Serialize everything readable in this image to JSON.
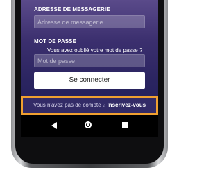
{
  "login": {
    "email_label": "ADRESSE DE MESSAGERIE",
    "email_placeholder": "Adresse de messagerie",
    "password_label": "MOT DE PASSE",
    "forgot_password": "Vous avez oublié votre mot de passe ?",
    "password_placeholder": "Mot de passe",
    "connect_button": "Se connecter"
  },
  "signup": {
    "prompt": "Vous n'avez pas de compte ?",
    "link": "Inscrivez-vous"
  },
  "navbar": {
    "back_icon": "back-triangle-icon",
    "home_icon": "home-circle-icon",
    "recent_icon": "recent-square-icon"
  },
  "colors": {
    "highlight": "#f0a030",
    "screen_bg": "#2a2460"
  }
}
